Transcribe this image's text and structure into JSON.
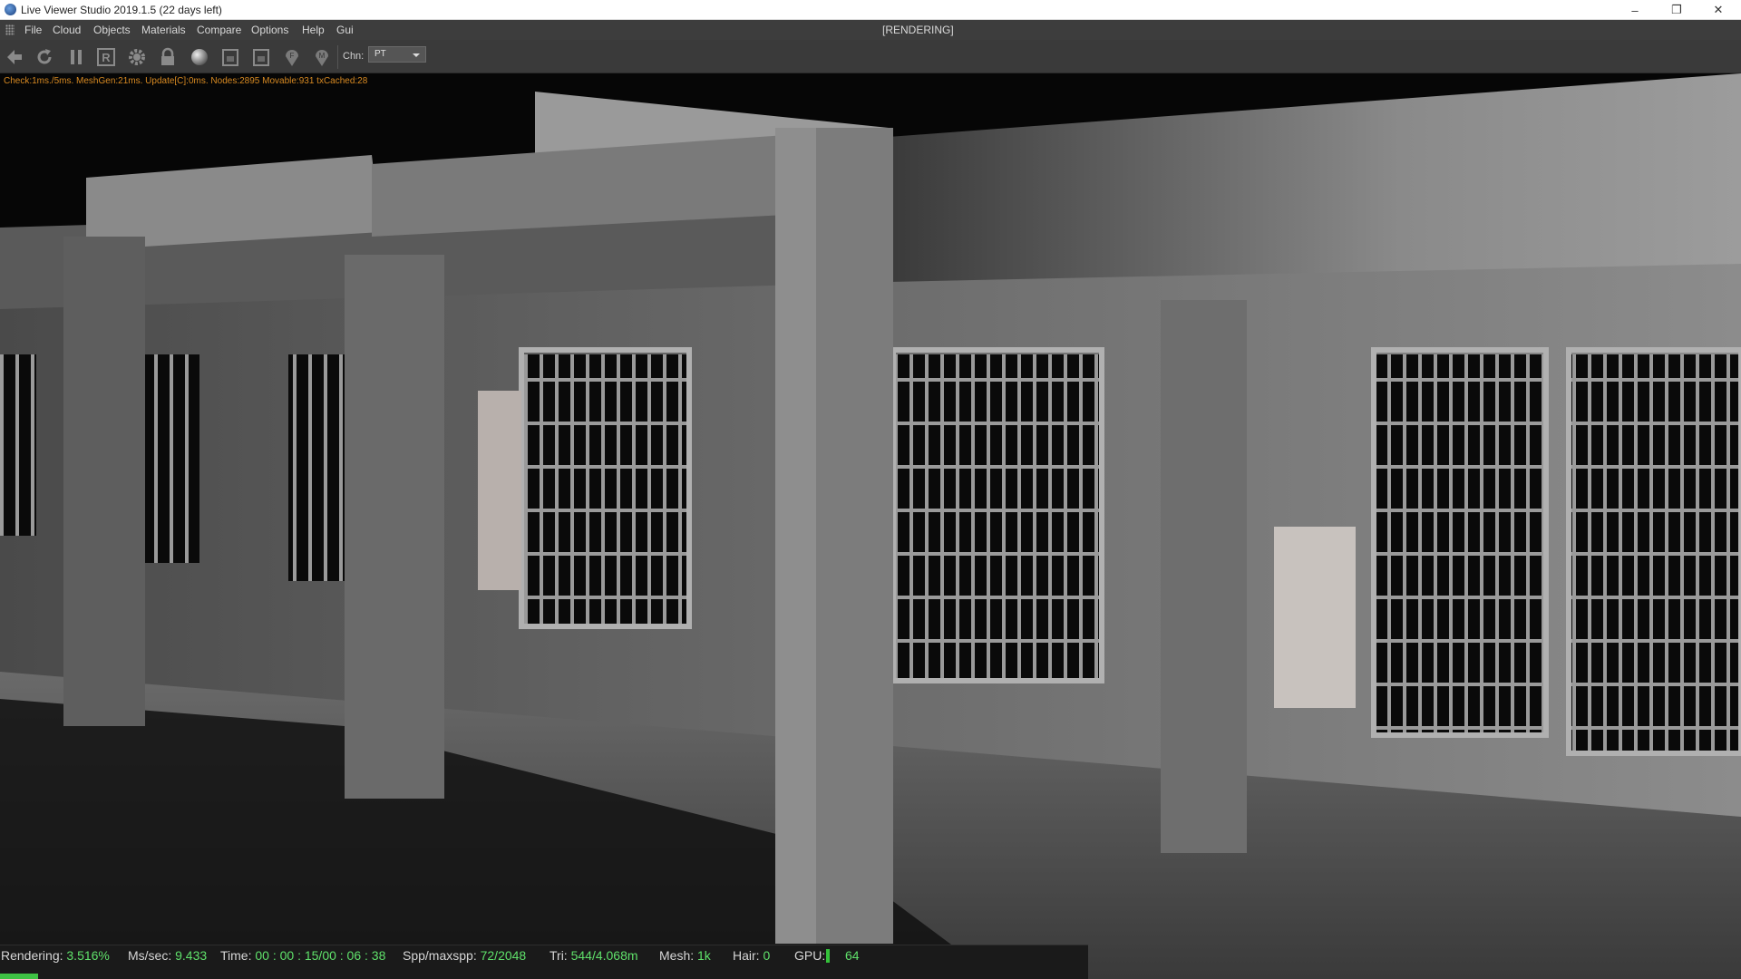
{
  "window": {
    "title": "Live Viewer Studio 2019.1.5 (22 days left)",
    "controls": {
      "minimize": "–",
      "maximize": "❐",
      "close": "✕"
    }
  },
  "menu": {
    "items": [
      "File",
      "Cloud",
      "Objects",
      "Materials",
      "Compare",
      "Options",
      "Help",
      "Gui"
    ],
    "status": "[RENDERING]"
  },
  "toolbar": {
    "icons": [
      "send-to-viewer-icon",
      "restart-render-icon",
      "pause-render-icon",
      "region-render-icon",
      "settings-gear-icon",
      "lock-icon",
      "material-ball-icon",
      "clay-render-icon",
      "screenshot-icon",
      "pick-focus-icon",
      "pick-material-icon"
    ],
    "channel_label": "Chn:",
    "channel_value": "PT"
  },
  "viewport": {
    "stats_overlay": "Check:1ms./5ms. MeshGen:21ms. Update[C]:0ms. Nodes:2895 Movable:931 txCached:28"
  },
  "statusbar": {
    "rendering_label": "Rendering:",
    "rendering_value": "3.516%",
    "mssec_label": "Ms/sec:",
    "mssec_value": "9.433",
    "time_label": "Time:",
    "time_value": "00 : 00 : 15/00 : 06 : 38",
    "spp_label": "Spp/maxspp:",
    "spp_value": "72/2048",
    "tri_label": "Tri:",
    "tri_value": "544/4.068m",
    "mesh_label": "Mesh:",
    "mesh_value": "1k",
    "hair_label": "Hair:",
    "hair_value": "0",
    "gpu_label": "GPU:",
    "gpu_value": "64",
    "progress_fraction": 0.03516
  },
  "colors": {
    "status_value": "#5fe06a",
    "stats_overlay": "#d88a22",
    "progress": "#3ec244"
  }
}
